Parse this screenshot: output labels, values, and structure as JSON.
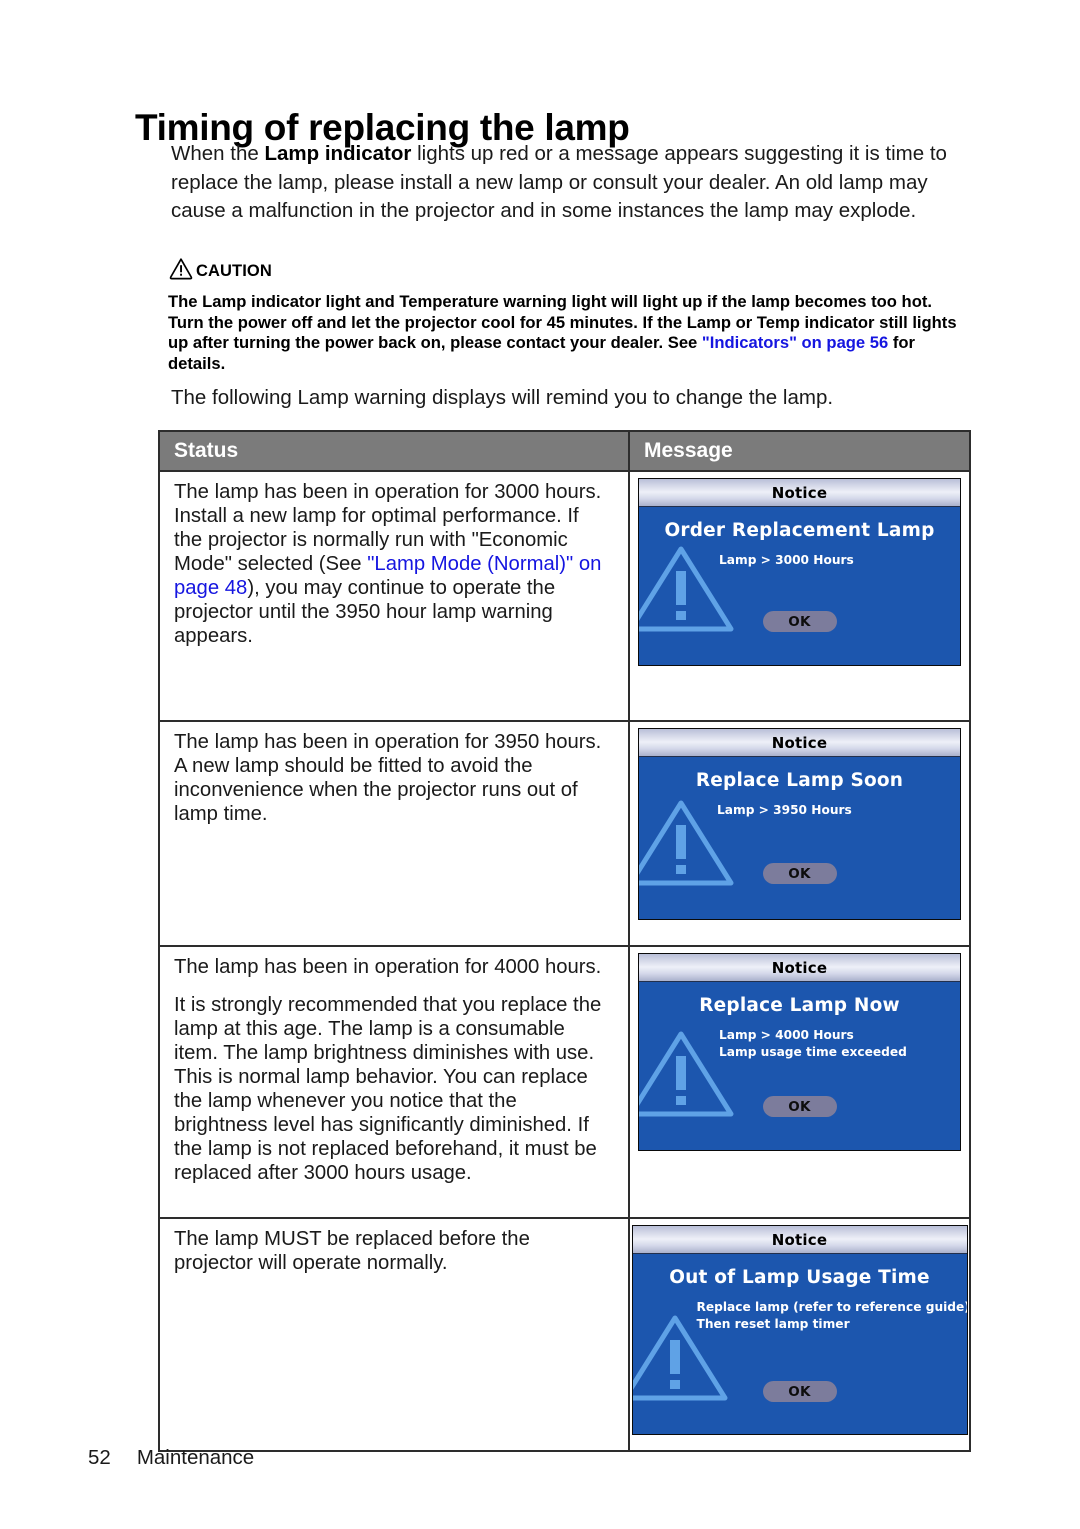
{
  "page": {
    "title": "Timing of replacing the lamp",
    "intro_pre": "When the ",
    "intro_bold": "Lamp indicator",
    "intro_post": " lights up red or a message appears suggesting it is time to replace the lamp, please install a new lamp or consult your dealer. An old lamp may cause a malfunction in the projector and in some instances the lamp may explode.",
    "follow_note": "The following Lamp warning displays will remind you to change the lamp."
  },
  "caution": {
    "icon": "warning-triangle-icon",
    "label": "CAUTION",
    "body_part1": "The Lamp indicator light and Temperature warning light will light up if the lamp becomes too hot. Turn the power off and let the projector cool for 45 minutes. If the Lamp or Temp indicator still lights up after turning the power back on, please contact your dealer. See ",
    "body_link": "\"Indicators\" on page 56",
    "body_part2": " for details."
  },
  "table": {
    "headers": {
      "status": "Status",
      "message": "Message"
    },
    "rows": [
      {
        "status_paragraphs": [
          {
            "pre": "The lamp has been in operation for 3000 hours. Install a new lamp for optimal performance. If the projector is normally run with \"Economic Mode\" selected (See ",
            "link": "\"Lamp Mode (Normal)\" on page 48",
            "post": "), you may continue to operate the projector until the 3950 hour lamp warning appears."
          }
        ],
        "dialog": {
          "titlebar": "Notice",
          "heading": "Order Replacement Lamp",
          "lines": [
            "Lamp > 3000 Hours"
          ],
          "ok_label": "OK"
        }
      },
      {
        "status_paragraphs": [
          {
            "pre": "The lamp has been in operation for 3950 hours. A new lamp should be fitted to avoid the inconvenience when the projector runs out of lamp time.",
            "link": "",
            "post": ""
          }
        ],
        "dialog": {
          "titlebar": "Notice",
          "heading": "Replace Lamp Soon",
          "lines": [
            "Lamp > 3950 Hours"
          ],
          "ok_label": "OK"
        }
      },
      {
        "status_paragraphs": [
          {
            "pre": "The lamp has been in operation for 4000 hours.",
            "link": "",
            "post": ""
          },
          {
            "pre": "It is strongly recommended that you replace the lamp at this age. The lamp is a consumable item. The lamp brightness diminishes with use. This is normal lamp behavior. You can replace the lamp whenever you notice that the brightness level has significantly diminished. If the lamp is not replaced beforehand, it must be replaced after 3000 hours usage.",
            "link": "",
            "post": ""
          }
        ],
        "dialog": {
          "titlebar": "Notice",
          "heading": "Replace Lamp Now",
          "lines": [
            "Lamp > 4000 Hours",
            "Lamp usage time exceeded"
          ],
          "ok_label": "OK"
        }
      },
      {
        "status_paragraphs": [
          {
            "pre": "The lamp MUST be replaced before the projector will operate normally.",
            "link": "",
            "post": ""
          }
        ],
        "dialog": {
          "titlebar": "Notice",
          "heading": "Out of Lamp Usage Time",
          "lines": [
            "Replace lamp (refer to reference guide)",
            "Then reset lamp timer"
          ],
          "ok_label": "OK"
        }
      }
    ]
  },
  "footer": {
    "page_number": "52",
    "section": "Maintenance"
  },
  "colors": {
    "link": "#1515e0",
    "table_header_bg": "#7b7b7b",
    "osd_blue": "#1c56ae",
    "osd_triangle": "#5c9ee0",
    "osd_button": "#7c7c9c"
  }
}
